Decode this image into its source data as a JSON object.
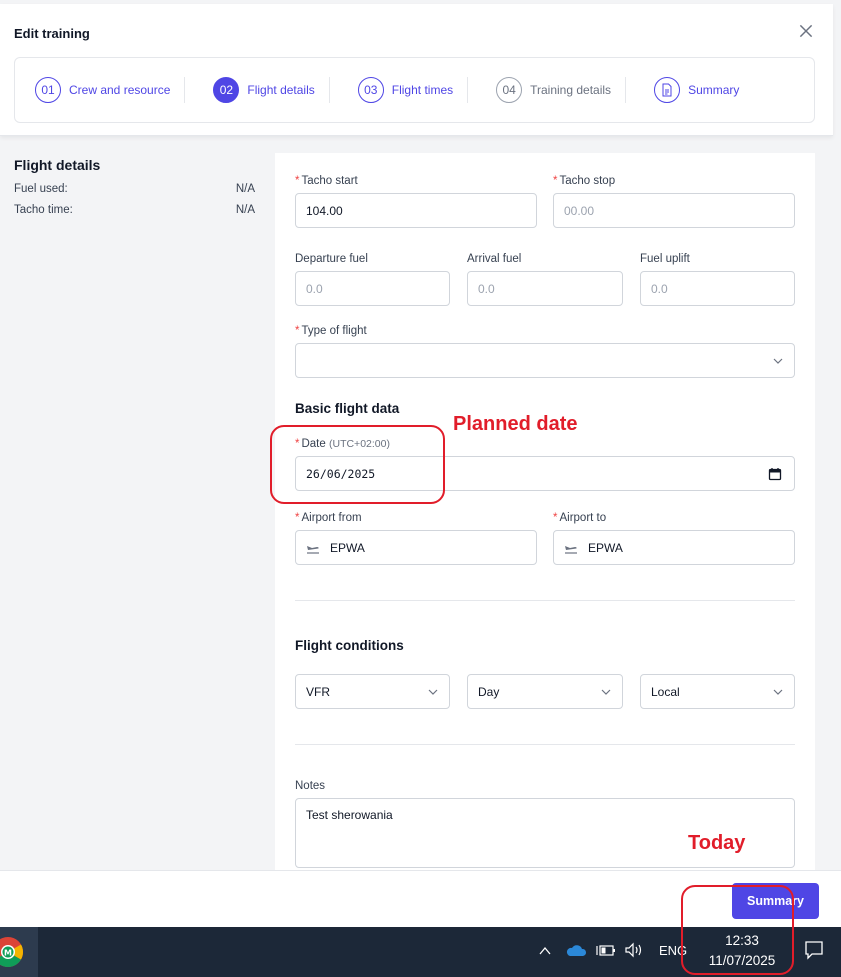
{
  "modal": {
    "title": "Edit training",
    "steps": [
      {
        "num": "01",
        "label": "Crew and resource"
      },
      {
        "num": "02",
        "label": "Flight details"
      },
      {
        "num": "03",
        "label": "Flight times"
      },
      {
        "num": "04",
        "label": "Training details"
      },
      {
        "label": "Summary"
      }
    ]
  },
  "left": {
    "title": "Flight details",
    "rows": [
      {
        "label": "Fuel used:",
        "value": "N/A"
      },
      {
        "label": "Tacho time:",
        "value": "N/A"
      }
    ]
  },
  "form": {
    "tacho_start": {
      "label": "Tacho start",
      "value": "104.00"
    },
    "tacho_stop": {
      "label": "Tacho stop",
      "placeholder": "00.00"
    },
    "departure_fuel": {
      "label": "Departure fuel",
      "placeholder": "0.0"
    },
    "arrival_fuel": {
      "label": "Arrival fuel",
      "placeholder": "0.0"
    },
    "fuel_uplift": {
      "label": "Fuel uplift",
      "placeholder": "0.0"
    },
    "type_of_flight": {
      "label": "Type of flight",
      "value": ""
    },
    "basic_title": "Basic flight data",
    "date": {
      "label": "Date",
      "hint": "(UTC+02:00)",
      "value": "26/06/2025"
    },
    "airport_from": {
      "label": "Airport from",
      "value": "EPWA"
    },
    "airport_to": {
      "label": "Airport to",
      "value": "EPWA"
    },
    "conditions_title": "Flight conditions",
    "conditions": [
      "VFR",
      "Day",
      "Local"
    ],
    "notes": {
      "label": "Notes",
      "value": "Test sherowania"
    }
  },
  "annotations": {
    "planned": "Planned date",
    "today": "Today"
  },
  "footer": {
    "summary_button": "Summary"
  },
  "taskbar": {
    "language": "ENG",
    "time": "12:33",
    "date": "11/07/2025"
  },
  "colors": {
    "accent": "#4f46e5",
    "annotation": "#e11d2a",
    "required": "#ef4444"
  }
}
